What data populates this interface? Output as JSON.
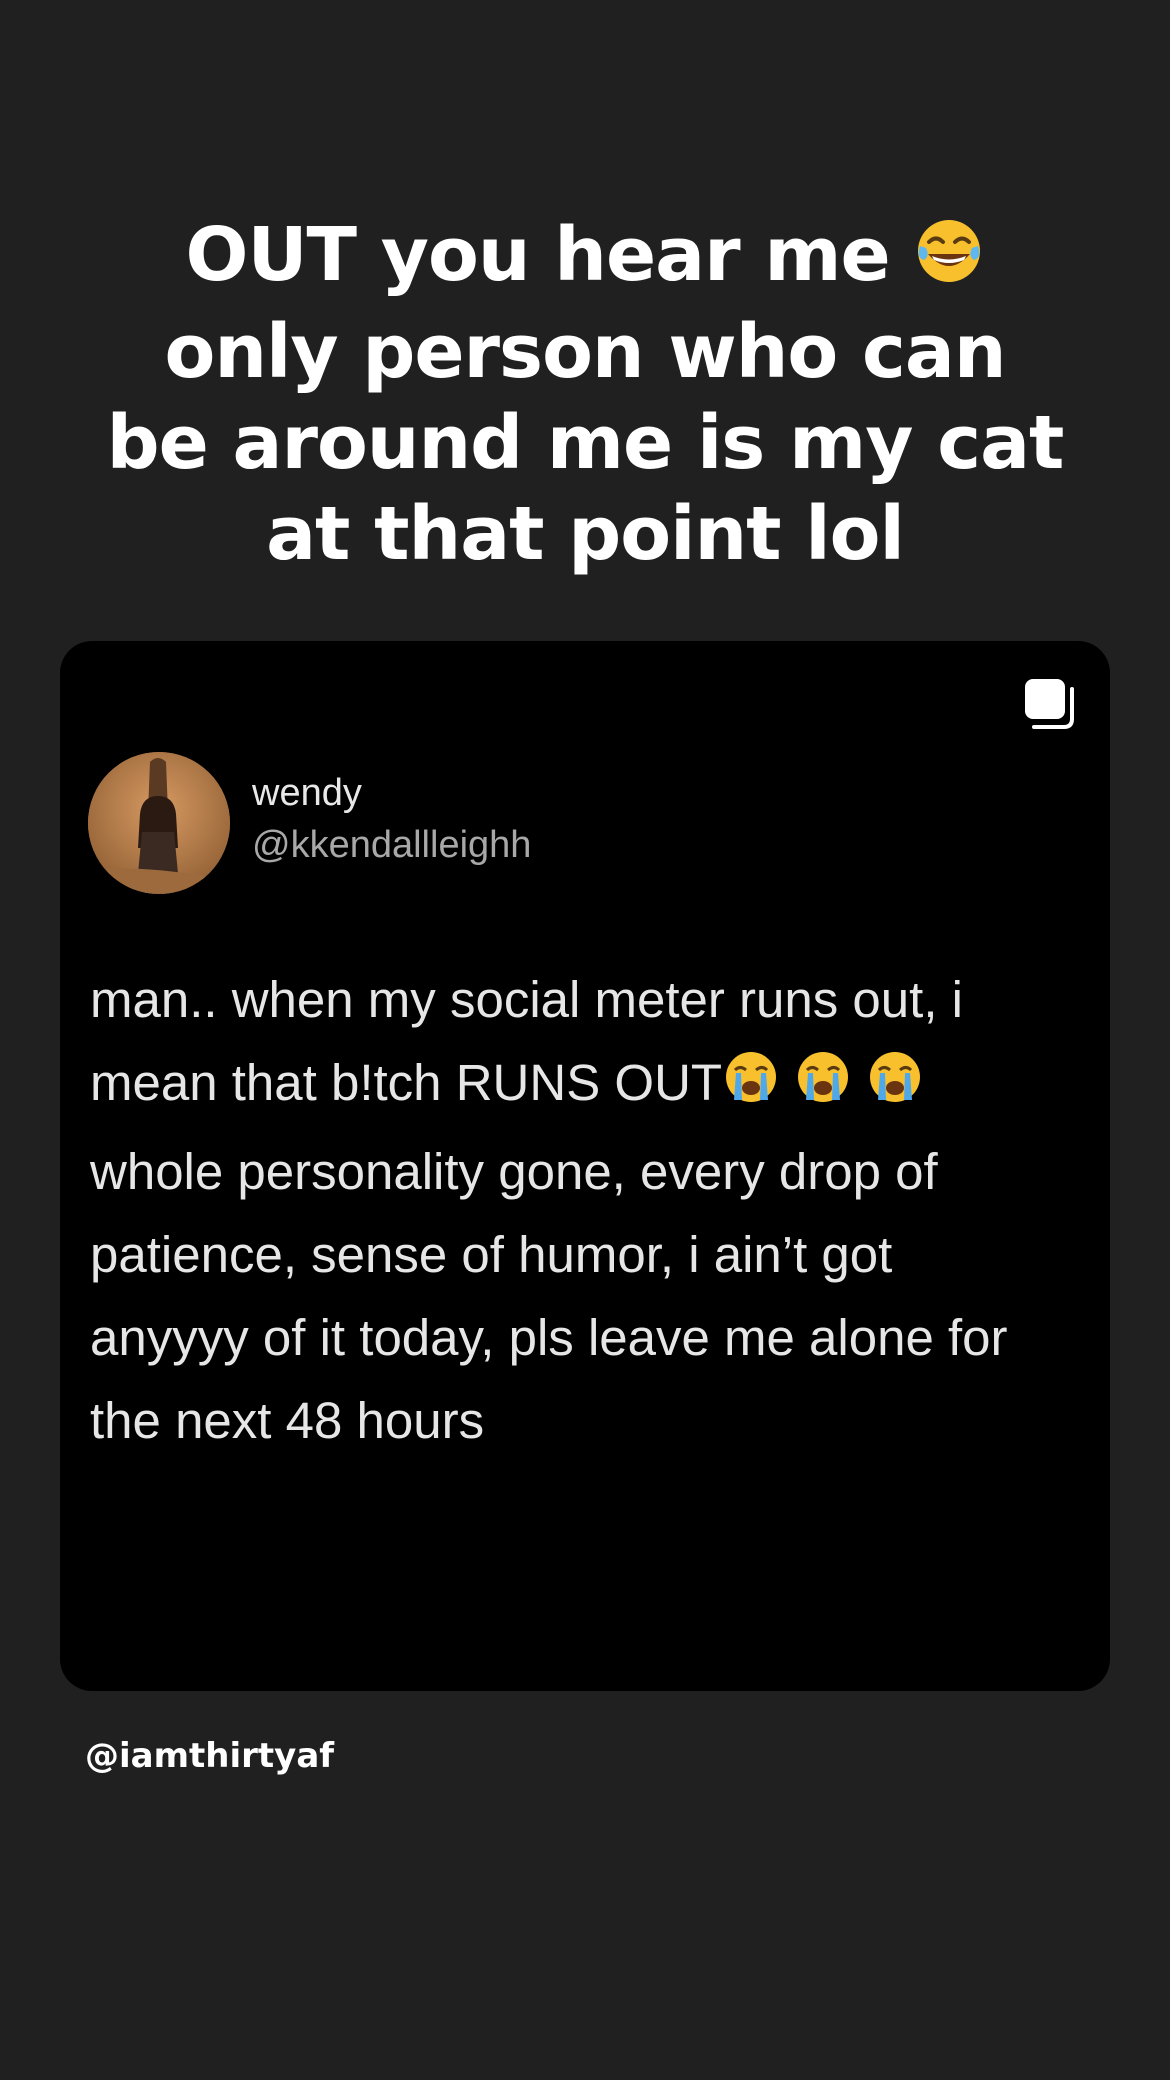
{
  "story": {
    "caption_lines": [
      "OUT you hear me",
      "only person who can",
      "be around me is my cat",
      "at that point lol"
    ],
    "caption_emoji": "face-with-tears-of-joy-icon",
    "credit": "@iamthirtyaf"
  },
  "post": {
    "multi_image_indicator": "carousel-icon",
    "tweet": {
      "display_name": "wendy",
      "handle": "@kkendallleighh",
      "lines": [
        "man.. when my social meter runs out, i",
        "mean that b!tch RUNS OUT",
        "whole personality gone, every drop of",
        "patience, sense of humor, i ain’t got",
        "anyyyy of it today, pls leave me alone for",
        "the next 48 hours"
      ],
      "line2_emojis": [
        "loudly-crying-face-icon",
        "loudly-crying-face-icon",
        "loudly-crying-face-icon"
      ]
    }
  }
}
